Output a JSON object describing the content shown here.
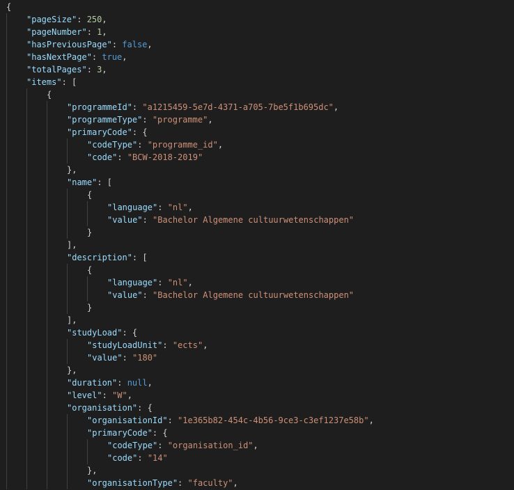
{
  "editor": {
    "lines": [
      {
        "indent": 0,
        "tokens": [
          [
            "p",
            "{"
          ]
        ]
      },
      {
        "indent": 1,
        "tokens": [
          [
            "k",
            "\"pageSize\""
          ],
          [
            "p",
            ": "
          ],
          [
            "n",
            "250"
          ],
          [
            "p",
            ","
          ]
        ]
      },
      {
        "indent": 1,
        "tokens": [
          [
            "k",
            "\"pageNumber\""
          ],
          [
            "p",
            ": "
          ],
          [
            "n",
            "1"
          ],
          [
            "p",
            ","
          ]
        ]
      },
      {
        "indent": 1,
        "tokens": [
          [
            "k",
            "\"hasPreviousPage\""
          ],
          [
            "p",
            ": "
          ],
          [
            "b",
            "false"
          ],
          [
            "p",
            ","
          ]
        ]
      },
      {
        "indent": 1,
        "tokens": [
          [
            "k",
            "\"hasNextPage\""
          ],
          [
            "p",
            ": "
          ],
          [
            "b",
            "true"
          ],
          [
            "p",
            ","
          ]
        ]
      },
      {
        "indent": 1,
        "tokens": [
          [
            "k",
            "\"totalPages\""
          ],
          [
            "p",
            ": "
          ],
          [
            "n",
            "3"
          ],
          [
            "p",
            ","
          ]
        ]
      },
      {
        "indent": 1,
        "tokens": [
          [
            "k",
            "\"items\""
          ],
          [
            "p",
            ": ["
          ]
        ]
      },
      {
        "indent": 2,
        "tokens": [
          [
            "p",
            "{"
          ]
        ]
      },
      {
        "indent": 3,
        "tokens": [
          [
            "k",
            "\"programmeId\""
          ],
          [
            "p",
            ": "
          ],
          [
            "s",
            "\"a1215459-5e7d-4371-a705-7be5f1b695dc\""
          ],
          [
            "p",
            ","
          ]
        ]
      },
      {
        "indent": 3,
        "tokens": [
          [
            "k",
            "\"programmeType\""
          ],
          [
            "p",
            ": "
          ],
          [
            "s",
            "\"programme\""
          ],
          [
            "p",
            ","
          ]
        ]
      },
      {
        "indent": 3,
        "tokens": [
          [
            "k",
            "\"primaryCode\""
          ],
          [
            "p",
            ": {"
          ]
        ]
      },
      {
        "indent": 4,
        "tokens": [
          [
            "k",
            "\"codeType\""
          ],
          [
            "p",
            ": "
          ],
          [
            "s",
            "\"programme_id\""
          ],
          [
            "p",
            ","
          ]
        ]
      },
      {
        "indent": 4,
        "tokens": [
          [
            "k",
            "\"code\""
          ],
          [
            "p",
            ": "
          ],
          [
            "s",
            "\"BCW-2018-2019\""
          ]
        ]
      },
      {
        "indent": 3,
        "tokens": [
          [
            "p",
            "},"
          ]
        ]
      },
      {
        "indent": 3,
        "tokens": [
          [
            "k",
            "\"name\""
          ],
          [
            "p",
            ": ["
          ]
        ]
      },
      {
        "indent": 4,
        "tokens": [
          [
            "p",
            "{"
          ]
        ]
      },
      {
        "indent": 5,
        "tokens": [
          [
            "k",
            "\"language\""
          ],
          [
            "p",
            ": "
          ],
          [
            "s",
            "\"nl\""
          ],
          [
            "p",
            ","
          ]
        ]
      },
      {
        "indent": 5,
        "tokens": [
          [
            "k",
            "\"value\""
          ],
          [
            "p",
            ": "
          ],
          [
            "s",
            "\"Bachelor Algemene cultuurwetenschappen\""
          ]
        ]
      },
      {
        "indent": 4,
        "tokens": [
          [
            "p",
            "}"
          ]
        ]
      },
      {
        "indent": 3,
        "tokens": [
          [
            "p",
            "],"
          ]
        ]
      },
      {
        "indent": 3,
        "tokens": [
          [
            "k",
            "\"description\""
          ],
          [
            "p",
            ": ["
          ]
        ]
      },
      {
        "indent": 4,
        "tokens": [
          [
            "p",
            "{"
          ]
        ]
      },
      {
        "indent": 5,
        "tokens": [
          [
            "k",
            "\"language\""
          ],
          [
            "p",
            ": "
          ],
          [
            "s",
            "\"nl\""
          ],
          [
            "p",
            ","
          ]
        ]
      },
      {
        "indent": 5,
        "tokens": [
          [
            "k",
            "\"value\""
          ],
          [
            "p",
            ": "
          ],
          [
            "s",
            "\"Bachelor Algemene cultuurwetenschappen\""
          ]
        ]
      },
      {
        "indent": 4,
        "tokens": [
          [
            "p",
            "}"
          ]
        ]
      },
      {
        "indent": 3,
        "tokens": [
          [
            "p",
            "],"
          ]
        ]
      },
      {
        "indent": 3,
        "tokens": [
          [
            "k",
            "\"studyLoad\""
          ],
          [
            "p",
            ": {"
          ]
        ]
      },
      {
        "indent": 4,
        "tokens": [
          [
            "k",
            "\"studyLoadUnit\""
          ],
          [
            "p",
            ": "
          ],
          [
            "s",
            "\"ects\""
          ],
          [
            "p",
            ","
          ]
        ]
      },
      {
        "indent": 4,
        "tokens": [
          [
            "k",
            "\"value\""
          ],
          [
            "p",
            ": "
          ],
          [
            "s",
            "\"180\""
          ]
        ]
      },
      {
        "indent": 3,
        "tokens": [
          [
            "p",
            "},"
          ]
        ]
      },
      {
        "indent": 3,
        "tokens": [
          [
            "k",
            "\"duration\""
          ],
          [
            "p",
            ": "
          ],
          [
            "b",
            "null"
          ],
          [
            "p",
            ","
          ]
        ]
      },
      {
        "indent": 3,
        "tokens": [
          [
            "k",
            "\"level\""
          ],
          [
            "p",
            ": "
          ],
          [
            "s",
            "\"W\""
          ],
          [
            "p",
            ","
          ]
        ]
      },
      {
        "indent": 3,
        "tokens": [
          [
            "k",
            "\"organisation\""
          ],
          [
            "p",
            ": {"
          ]
        ]
      },
      {
        "indent": 4,
        "tokens": [
          [
            "k",
            "\"organisationId\""
          ],
          [
            "p",
            ": "
          ],
          [
            "s",
            "\"1e365b82-454c-4b56-9ce3-c3ef1237e58b\""
          ],
          [
            "p",
            ","
          ]
        ]
      },
      {
        "indent": 4,
        "tokens": [
          [
            "k",
            "\"primaryCode\""
          ],
          [
            "p",
            ": {"
          ]
        ]
      },
      {
        "indent": 5,
        "tokens": [
          [
            "k",
            "\"codeType\""
          ],
          [
            "p",
            ": "
          ],
          [
            "s",
            "\"organisation_id\""
          ],
          [
            "p",
            ","
          ]
        ]
      },
      {
        "indent": 5,
        "tokens": [
          [
            "k",
            "\"code\""
          ],
          [
            "p",
            ": "
          ],
          [
            "s",
            "\"14\""
          ]
        ]
      },
      {
        "indent": 4,
        "tokens": [
          [
            "p",
            "},"
          ]
        ]
      },
      {
        "indent": 4,
        "tokens": [
          [
            "k",
            "\"organisationType\""
          ],
          [
            "p",
            ": "
          ],
          [
            "s",
            "\"faculty\""
          ],
          [
            "p",
            ","
          ]
        ]
      }
    ],
    "colors": {
      "background": "#1e1e1e",
      "key": "#9cdcfe",
      "string": "#ce9178",
      "number": "#b5cea8",
      "keyword": "#569cd6",
      "punctuation": "#d4d4d4",
      "indent_guide": "#404040"
    }
  }
}
